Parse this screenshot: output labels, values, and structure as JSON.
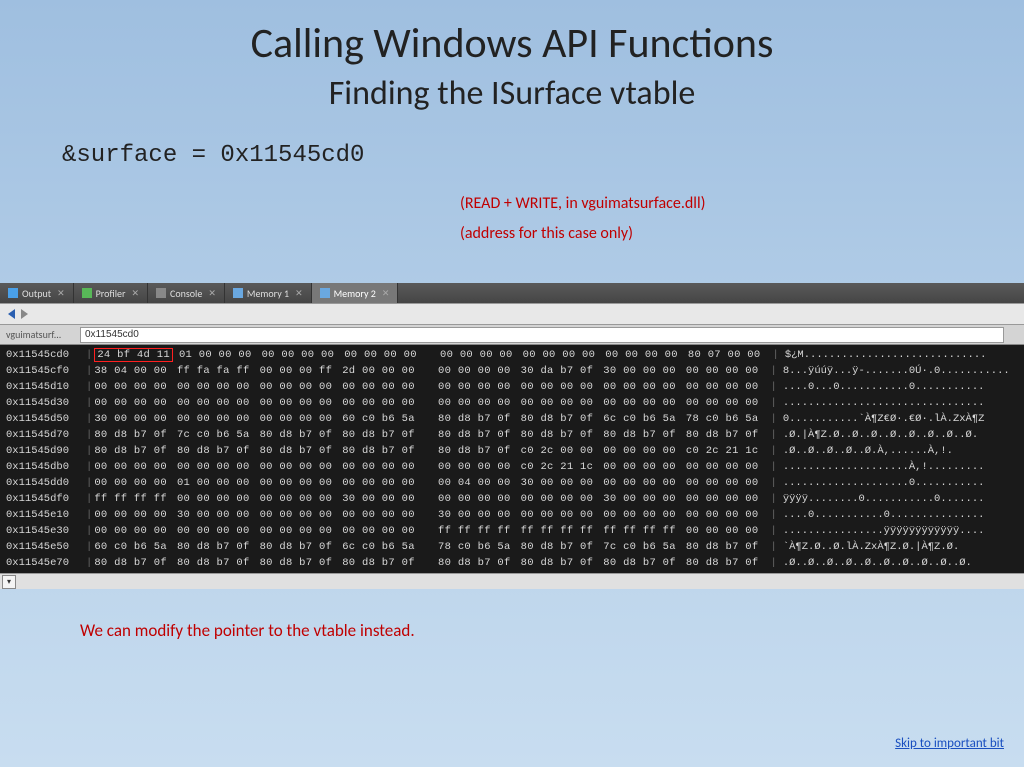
{
  "title": {
    "main": "Calling Windows API Functions",
    "sub": "Finding the ISurface vtable"
  },
  "code_line": "&surface = 0x11545cd0",
  "notes": {
    "rw": "(READ + WRITE, in vguimatsurface.dll)",
    "case": "(address for this case only)"
  },
  "tabs": [
    {
      "label": "Output",
      "icon": "output-icon"
    },
    {
      "label": "Profiler",
      "icon": "profiler-icon"
    },
    {
      "label": "Console",
      "icon": "console-icon"
    },
    {
      "label": "Memory 1",
      "icon": "memory-icon"
    },
    {
      "label": "Memory 2",
      "icon": "memory-icon",
      "active": true
    }
  ],
  "address_bar": {
    "label": "vguimatsurf...",
    "value": "0x11545cd0"
  },
  "hex_rows": [
    {
      "addr": "0x11545cd0",
      "g": [
        "24 bf 4d 11",
        "01 00 00 00",
        "00 00 00 00",
        "00 00 00 00",
        "00 00 00 00",
        "00 00 00 00",
        "00 00 00 00",
        "80 07 00 00"
      ],
      "asc": "$¿M.............................",
      "hl": true
    },
    {
      "addr": "0x11545cf0",
      "g": [
        "38 04 00 00",
        "ff fa fa ff",
        "00 00 00 ff",
        "2d 00 00 00",
        "00 00 00 00",
        "30 da b7 0f",
        "30 00 00 00",
        "00 00 00 00"
      ],
      "asc": "8...ÿúúÿ...ÿ-.......0Ú·.0..........."
    },
    {
      "addr": "0x11545d10",
      "g": [
        "00 00 00 00",
        "00 00 00 00",
        "00 00 00 00",
        "00 00 00 00",
        "00 00 00 00",
        "00 00 00 00",
        "00 00 00 00",
        "00 00 00 00"
      ],
      "asc": "....0...0...........0..........."
    },
    {
      "addr": "0x11545d30",
      "g": [
        "00 00 00 00",
        "00 00 00 00",
        "00 00 00 00",
        "00 00 00 00",
        "00 00 00 00",
        "00 00 00 00",
        "00 00 00 00",
        "00 00 00 00"
      ],
      "asc": "................................"
    },
    {
      "addr": "0x11545d50",
      "g": [
        "30 00 00 00",
        "00 00 00 00",
        "00 00 00 00",
        "60 c0 b6 5a",
        "80 d8 b7 0f",
        "80 d8 b7 0f",
        "6c c0 b6 5a",
        "78 c0 b6 5a"
      ],
      "asc": "0...........`À¶Z€Ø·.€Ø·.lÀ.ZxÀ¶Z"
    },
    {
      "addr": "0x11545d70",
      "g": [
        "80 d8 b7 0f",
        "7c c0 b6 5a",
        "80 d8 b7 0f",
        "80 d8 b7 0f",
        "80 d8 b7 0f",
        "80 d8 b7 0f",
        "80 d8 b7 0f",
        "80 d8 b7 0f"
      ],
      "asc": ".Ø.|À¶Z.Ø..Ø..Ø..Ø..Ø..Ø..Ø..Ø."
    },
    {
      "addr": "0x11545d90",
      "g": [
        "80 d8 b7 0f",
        "80 d8 b7 0f",
        "80 d8 b7 0f",
        "80 d8 b7 0f",
        "80 d8 b7 0f",
        "c0 2c 00 00",
        "00 00 00 00",
        "c0 2c 21 1c"
      ],
      "asc": ".Ø..Ø..Ø..Ø..Ø.À,......À,!."
    },
    {
      "addr": "0x11545db0",
      "g": [
        "00 00 00 00",
        "00 00 00 00",
        "00 00 00 00",
        "00 00 00 00",
        "00 00 00 00",
        "c0 2c 21 1c",
        "00 00 00 00",
        "00 00 00 00"
      ],
      "asc": "....................À,!........."
    },
    {
      "addr": "0x11545dd0",
      "g": [
        "00 00 00 00",
        "01 00 00 00",
        "00 00 00 00",
        "00 00 00 00",
        "00 04 00 00",
        "30 00 00 00",
        "00 00 00 00",
        "00 00 00 00"
      ],
      "asc": "....................0..........."
    },
    {
      "addr": "0x11545df0",
      "g": [
        "ff ff ff ff",
        "00 00 00 00",
        "00 00 00 00",
        "30 00 00 00",
        "00 00 00 00",
        "00 00 00 00",
        "30 00 00 00",
        "00 00 00 00"
      ],
      "asc": "ÿÿÿÿ........0...........0......."
    },
    {
      "addr": "0x11545e10",
      "g": [
        "00 00 00 00",
        "30 00 00 00",
        "00 00 00 00",
        "00 00 00 00",
        "30 00 00 00",
        "00 00 00 00",
        "00 00 00 00",
        "00 00 00 00"
      ],
      "asc": "....0...........0..............."
    },
    {
      "addr": "0x11545e30",
      "g": [
        "00 00 00 00",
        "00 00 00 00",
        "00 00 00 00",
        "00 00 00 00",
        "ff ff ff ff",
        "ff ff ff ff",
        "ff ff ff ff",
        "00 00 00 00"
      ],
      "asc": "................ÿÿÿÿÿÿÿÿÿÿÿÿ...."
    },
    {
      "addr": "0x11545e50",
      "g": [
        "60 c0 b6 5a",
        "80 d8 b7 0f",
        "80 d8 b7 0f",
        "6c c0 b6 5a",
        "78 c0 b6 5a",
        "80 d8 b7 0f",
        "7c c0 b6 5a",
        "80 d8 b7 0f"
      ],
      "asc": "`À¶Z.Ø..Ø.lÀ.ZxÀ¶Z.Ø.|À¶Z.Ø."
    },
    {
      "addr": "0x11545e70",
      "g": [
        "80 d8 b7 0f",
        "80 d8 b7 0f",
        "80 d8 b7 0f",
        "80 d8 b7 0f",
        "80 d8 b7 0f",
        "80 d8 b7 0f",
        "80 d8 b7 0f",
        "80 d8 b7 0f"
      ],
      "asc": ".Ø..Ø..Ø..Ø..Ø..Ø..Ø..Ø..Ø..Ø."
    }
  ],
  "footnote": "We can modify the pointer to the vtable instead.",
  "skip_link": "Skip to important bit"
}
